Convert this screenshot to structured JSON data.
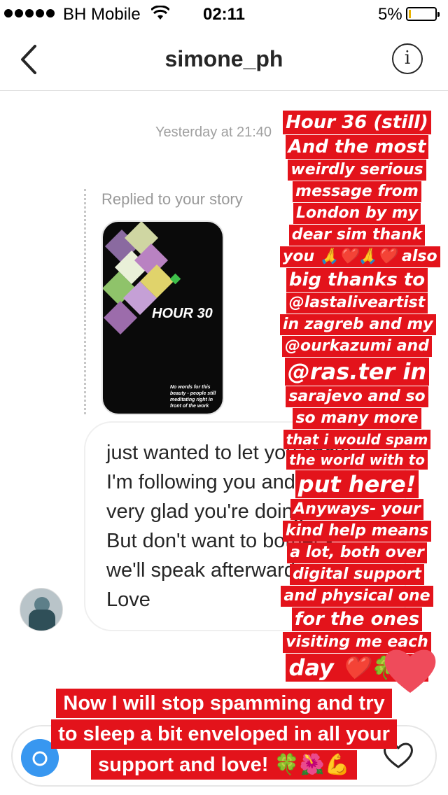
{
  "status_bar": {
    "carrier": "BH Mobile",
    "time": "02:11",
    "battery_percent": "5%",
    "battery_level": 0.05
  },
  "nav": {
    "title": "simone_ph",
    "info_glyph": "i"
  },
  "thread": {
    "timestamp": "Yesterday at 21:40",
    "reply_label": "Replied to your story",
    "story_preview": {
      "title": "HOUR 30",
      "caption": "No words for this beauty - people still meditating right in front of the work"
    },
    "message": "just wanted to let you know\nI'm following you and I'm\nvery glad you're doing it!\nBut don't want to bother -\nwe'll speak afterwards\nLove"
  },
  "overlay": {
    "lines": [
      {
        "text": "Hour 36 (still)",
        "size": "med"
      },
      {
        "text": "And the most",
        "size": "med"
      },
      {
        "text": "weirdly serious",
        "size": ""
      },
      {
        "text": "message from",
        "size": ""
      },
      {
        "text": "London by my",
        "size": ""
      },
      {
        "text": "dear sim thank",
        "size": ""
      },
      {
        "text": "you 🙏❤️🙏❤️ also",
        "size": ""
      },
      {
        "text": "big thanks to",
        "size": "med"
      },
      {
        "text": "@lastaliveartist",
        "size": ""
      },
      {
        "text": "in zagreb and my",
        "size": ""
      },
      {
        "text": "@ourkazumi and",
        "size": ""
      },
      {
        "text": "@ras.ter in",
        "size": "big"
      },
      {
        "text": "sarajevo and so",
        "size": ""
      },
      {
        "text": "so many more",
        "size": ""
      },
      {
        "text": "that i would spam",
        "size": "small"
      },
      {
        "text": "the world with to",
        "size": "small"
      },
      {
        "text": "put here!",
        "size": "big"
      },
      {
        "text": "Anyways- your",
        "size": ""
      },
      {
        "text": "kind help means",
        "size": ""
      },
      {
        "text": "a lot, both over",
        "size": ""
      },
      {
        "text": "digital support",
        "size": ""
      },
      {
        "text": "and physical one",
        "size": ""
      },
      {
        "text": "for the ones",
        "size": "med"
      },
      {
        "text": "visiting me each",
        "size": ""
      },
      {
        "text": "day ❤️🍀💪",
        "size": "big"
      }
    ]
  },
  "bottom_banner": {
    "lines": [
      "Now I will stop spamming and try",
      "to sleep a bit enveloped in all your",
      "support and love! 🍀🌺💪"
    ]
  },
  "icons": {
    "back": "chevron-left-icon",
    "info": "info-icon",
    "wifi": "wifi-icon",
    "battery": "battery-icon",
    "camera": "camera-icon",
    "heart": "heart-icon"
  },
  "colors": {
    "accent_red": "#e3131b",
    "camera_blue": "#3897f0",
    "battery_yellow": "#e8b200"
  }
}
